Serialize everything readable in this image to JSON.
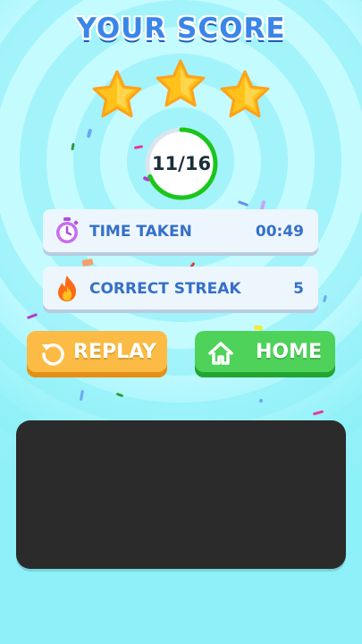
{
  "screen": {
    "title": "YOUR SCORE",
    "stars_earned": 3,
    "stars_total": 3,
    "score": {
      "text": "11/16",
      "correct": 11,
      "total": 16
    }
  },
  "stats": [
    {
      "label": "TIME TAKEN",
      "value": "00:49",
      "icon": "stopwatch-icon"
    },
    {
      "label": "CORRECT STREAK",
      "value": "5",
      "icon": "fire-icon"
    }
  ],
  "buttons": {
    "replay": {
      "label": "REPLAY",
      "icon": "replay-icon"
    },
    "home": {
      "label": "HOME",
      "icon": "home-icon"
    }
  },
  "colors": {
    "background": "#8ef0f8",
    "title": "#3a86e8",
    "star": "#ffc21a",
    "progress": "#1bc61b",
    "stat_text": "#3470c9",
    "replay_button": "#fbbb44",
    "home_button": "#4ed25a",
    "ad_panel": "#2b2b2b"
  }
}
